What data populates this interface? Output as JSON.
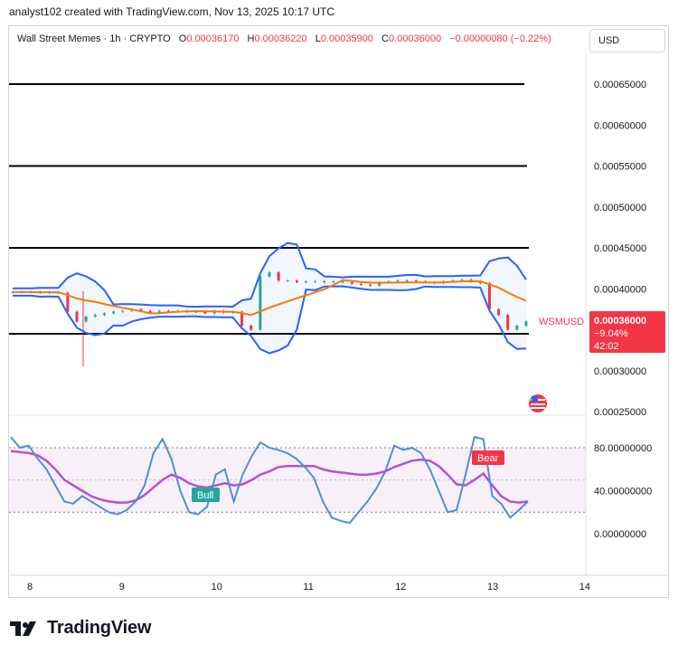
{
  "header": {
    "attribution": "analyst102 created with TradingView.com, Nov 13, 2025 10:17 UTC"
  },
  "legend": {
    "symbol": "Wall Street Memes · 1h · CRYPTO",
    "o_label": "O",
    "o": "0.00036170",
    "h_label": "H",
    "h": "0.00036220",
    "l_label": "L",
    "l": "0.00035900",
    "c_label": "C",
    "c": "0.00036000",
    "change": "−0.00000080 (−0.22%)"
  },
  "currency": "USD",
  "price_tag": {
    "symbol": "WSMUSD",
    "price": "0.00036000",
    "change_pct": "−9.04%",
    "countdown": "42:02",
    "color": "#f23645"
  },
  "branding": {
    "name": "TradingView"
  },
  "colors": {
    "up": "#26a69a",
    "down": "#f23645",
    "bb": "#2962ff",
    "ma": "#f57c00",
    "k": "#4a90d9",
    "d": "#b84fd6"
  },
  "chart_data": [
    {
      "type": "candlestick",
      "x_ticks": [
        "8",
        "9",
        "10",
        "11",
        "12",
        "13",
        "14"
      ],
      "y_ticks": [
        "0.00065000",
        "0.00060000",
        "0.00055000",
        "0.00050000",
        "0.00045000",
        "0.00040000",
        "0.00030000",
        "0.00025000"
      ],
      "ylim": [
        0.00025,
        0.00065
      ],
      "horizontal_levels": [
        0.00065,
        0.00055,
        0.00045,
        0.000345
      ],
      "approx_close": [
        0.000396,
        0.000396,
        0.000396,
        0.000395,
        0.000396,
        0.000395,
        0.000372,
        0.00036,
        0.000366,
        0.000368,
        0.00037,
        0.000372,
        0.000373,
        0.000375,
        0.000373,
        0.000371,
        0.000373,
        0.000372,
        0.000373,
        0.000372,
        0.000372,
        0.00037,
        0.000373,
        0.000371,
        0.000372,
        0.000355,
        0.00035,
        0.000415,
        0.00042,
        0.00041,
        0.00041,
        0.000408,
        0.000409,
        0.000409,
        0.000408,
        0.000409,
        0.000408,
        0.000406,
        0.000405,
        0.000404,
        0.000408,
        0.000409,
        0.00041,
        0.00041,
        0.000409,
        0.000408,
        0.000407,
        0.000409,
        0.00041,
        0.000411,
        0.000409,
        0.000407,
        0.000375,
        0.000368,
        0.00035,
        0.000355,
        0.00036
      ],
      "annotations": [
        "WSMUSD 0.00036000",
        "−9.04%",
        "42:02"
      ]
    },
    {
      "type": "line",
      "name": "stochastic",
      "y_ticks": [
        "80.00000000",
        "40.00000000",
        "0.00000000"
      ],
      "ylim": [
        -15,
        105
      ],
      "bands": [
        20,
        80
      ],
      "series": [
        {
          "values": [
            90,
            80,
            82,
            70,
            60,
            45,
            30,
            28,
            35,
            30,
            25,
            20,
            18,
            22,
            30,
            45,
            75,
            88,
            70,
            40,
            20,
            18,
            25,
            55,
            60,
            30,
            55,
            72,
            85,
            80,
            78,
            75,
            70,
            62,
            52,
            30,
            15,
            12,
            10,
            20,
            30,
            42,
            58,
            82,
            78,
            80,
            75,
            60,
            40,
            20,
            22,
            55,
            90,
            88,
            35,
            28,
            15,
            22,
            30
          ]
        },
        {
          "values": [
            77,
            76,
            75,
            73,
            68,
            60,
            50,
            45,
            40,
            35,
            32,
            30,
            29,
            29,
            31,
            36,
            43,
            50,
            55,
            52,
            47,
            44,
            43,
            45,
            47,
            45,
            46,
            50,
            55,
            58,
            62,
            63,
            63,
            63,
            63,
            60,
            58,
            57,
            56,
            55,
            55,
            56,
            58,
            62,
            65,
            68,
            69,
            68,
            63,
            55,
            46,
            45,
            50,
            56,
            45,
            35,
            30,
            29,
            30
          ]
        }
      ],
      "annotations": [
        "Bull",
        "Bear"
      ]
    }
  ]
}
